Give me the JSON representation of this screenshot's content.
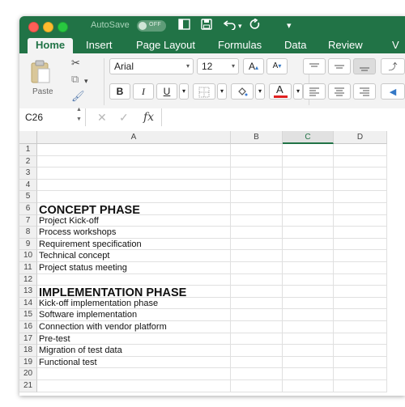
{
  "titlebar": {
    "autosave_label": "AutoSave",
    "autosave_state": "OFF",
    "quick_access_icons": [
      "sidebar-toggle-icon",
      "save-icon",
      "undo-icon",
      "undo-dropdown-icon",
      "redo-icon",
      "customize-icon"
    ]
  },
  "tabs": [
    {
      "label": "Home",
      "active": true
    },
    {
      "label": "Insert",
      "active": false
    },
    {
      "label": "Page Layout",
      "active": false
    },
    {
      "label": "Formulas",
      "active": false
    },
    {
      "label": "Data",
      "active": false
    },
    {
      "label": "Review",
      "active": false
    },
    {
      "label": "V",
      "active": false
    }
  ],
  "ribbon": {
    "paste_label": "Paste",
    "font_name": "Arial",
    "font_size": "12",
    "bold": "B",
    "italic": "I",
    "underline": "U",
    "grow_font": "A",
    "shrink_font": "A",
    "font_color_glyph": "A",
    "font_color": "#e02020"
  },
  "formula_bar": {
    "name_box": "C26",
    "fx": "fx",
    "content": ""
  },
  "sheet": {
    "columns": [
      "A",
      "B",
      "C",
      "D"
    ],
    "selected_column": "C",
    "rows": [
      {
        "num": "1",
        "a": "",
        "style": "normal"
      },
      {
        "num": "2",
        "a": "",
        "style": "normal"
      },
      {
        "num": "3",
        "a": "",
        "style": "normal"
      },
      {
        "num": "4",
        "a": "",
        "style": "normal"
      },
      {
        "num": "5",
        "a": "",
        "style": "normal"
      },
      {
        "num": "6",
        "a": "CONCEPT PHASE",
        "style": "head"
      },
      {
        "num": "7",
        "a": "Project Kick-off",
        "style": "normal"
      },
      {
        "num": "8",
        "a": "Process workshops",
        "style": "normal"
      },
      {
        "num": "9",
        "a": "Requirement specification",
        "style": "normal"
      },
      {
        "num": "10",
        "a": "Technical concept",
        "style": "normal"
      },
      {
        "num": "11",
        "a": "Project status meeting",
        "style": "normal"
      },
      {
        "num": "12",
        "a": "",
        "style": "normal"
      },
      {
        "num": "13",
        "a": "IMPLEMENTATION PHASE",
        "style": "head"
      },
      {
        "num": "14",
        "a": "Kick-off implementation phase",
        "style": "normal"
      },
      {
        "num": "15",
        "a": "Software implementation",
        "style": "normal"
      },
      {
        "num": "16",
        "a": "Connection with vendor platform",
        "style": "normal"
      },
      {
        "num": "17",
        "a": "Pre-test",
        "style": "normal"
      },
      {
        "num": "18",
        "a": "Migration of test data",
        "style": "normal"
      },
      {
        "num": "19",
        "a": "Functional test",
        "style": "normal"
      },
      {
        "num": "20",
        "a": "",
        "style": "normal"
      },
      {
        "num": "21",
        "a": "",
        "style": "normal"
      }
    ]
  },
  "colors": {
    "excel_green": "#217346",
    "selected_header": "#217346"
  }
}
